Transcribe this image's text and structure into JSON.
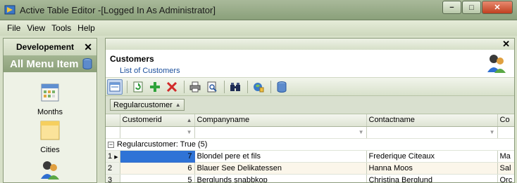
{
  "window": {
    "title": "Active Table Editor -[Logged In As Administrator]",
    "minimize": "−",
    "maximize": "□",
    "close": "✕"
  },
  "menu": {
    "items": [
      "File",
      "View",
      "Tools",
      "Help"
    ]
  },
  "left_panel": {
    "title": "Developement",
    "close": "✕",
    "section_title": "All Menu Item",
    "items": [
      {
        "label": "Months",
        "icon": "calendar-icon"
      },
      {
        "label": "Cities",
        "icon": "folder-icon"
      },
      {
        "label": "",
        "icon": "customers-icon"
      }
    ]
  },
  "right_panel": {
    "close": "✕",
    "form_title": "Customers",
    "form_subtitle": "List of Customers",
    "form_icon": "customers-icon"
  },
  "toolbar": {
    "buttons": [
      "form-view-icon",
      "refresh-icon",
      "add-icon",
      "delete-icon",
      "print-icon",
      "print-preview-icon",
      "binoculars-icon",
      "export-icon",
      "database-icon"
    ]
  },
  "grouping": {
    "chip_label": "Regularcustomer",
    "chip_arrow": "▲"
  },
  "grid": {
    "columns": [
      "Customerid",
      "Companyname",
      "Contactname",
      "Co"
    ],
    "group_toggle": "−",
    "group_label": "Regularcustomer: True (5)",
    "rows": [
      {
        "index": "1",
        "marker": "▶",
        "customerid": "7",
        "companyname": "Blondel pere et fils",
        "contactname": "Frederique Citeaux",
        "co": "Ma"
      },
      {
        "index": "2",
        "marker": "",
        "customerid": "6",
        "companyname": "Blauer See Delikatessen",
        "contactname": "Hanna Moos",
        "co": "Sal"
      },
      {
        "index": "3",
        "marker": "",
        "customerid": "5",
        "companyname": "Berglunds snabbkop",
        "contactname": "Christina Berglund",
        "co": "Orc"
      }
    ]
  },
  "colors": {
    "accent": "#2f73d6",
    "panel_green": "#8ca07a",
    "link_blue": "#1b4f9c"
  }
}
